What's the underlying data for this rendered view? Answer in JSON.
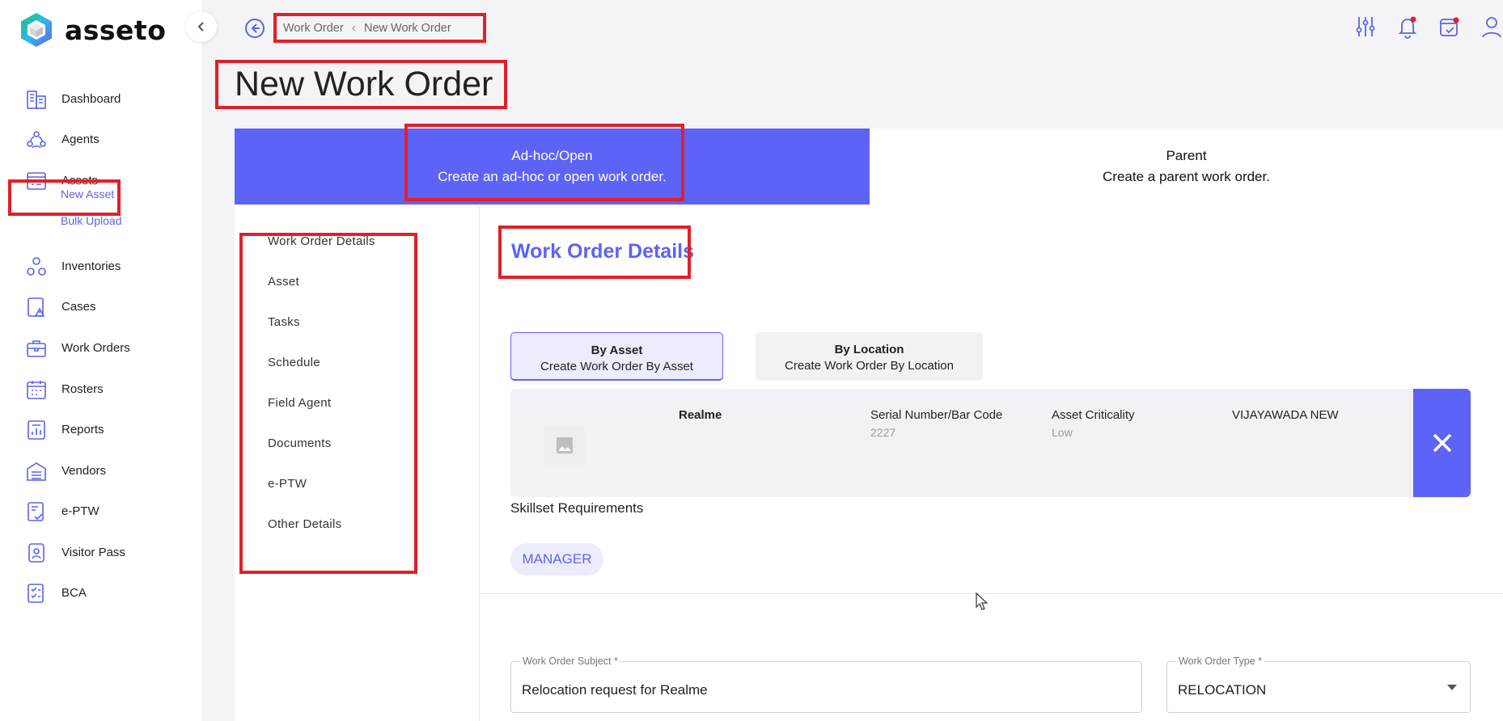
{
  "brand": {
    "name": "asseto"
  },
  "sidebar": {
    "items": [
      {
        "label": "Dashboard",
        "icon": "dashboard-icon"
      },
      {
        "label": "Agents",
        "icon": "agents-icon"
      },
      {
        "label": "Assets",
        "icon": "assets-icon"
      },
      {
        "label": "Inventories",
        "icon": "inventories-icon"
      },
      {
        "label": "Cases",
        "icon": "cases-icon"
      },
      {
        "label": "Work Orders",
        "icon": "work-orders-icon"
      },
      {
        "label": "Rosters",
        "icon": "rosters-icon"
      },
      {
        "label": "Reports",
        "icon": "reports-icon"
      },
      {
        "label": "Vendors",
        "icon": "vendors-icon"
      },
      {
        "label": "e-PTW",
        "icon": "eptw-icon"
      },
      {
        "label": "Visitor Pass",
        "icon": "visitor-pass-icon"
      },
      {
        "label": "BCA",
        "icon": "bca-icon"
      }
    ],
    "asset_subitems": [
      "New Asset",
      "Bulk Upload"
    ]
  },
  "breadcrumb": {
    "parent": "Work Order",
    "current": "New Work Order"
  },
  "page": {
    "title": "New Work Order"
  },
  "mode_tabs": [
    {
      "title": "Ad-hoc/Open",
      "subtitle": "Create an ad-hoc or open work order."
    },
    {
      "title": "Parent",
      "subtitle": "Create a parent work order."
    }
  ],
  "left_menu": [
    "Work Order Details",
    "Asset",
    "Tasks",
    "Schedule",
    "Field Agent",
    "Documents",
    "e-PTW",
    "Other Details"
  ],
  "section": {
    "title": "Work Order Details"
  },
  "segments": [
    {
      "title": "By Asset",
      "subtitle": "Create Work Order By Asset"
    },
    {
      "title": "By Location",
      "subtitle": "Create Work Order By Location"
    }
  ],
  "asset": {
    "name": "Realme",
    "serial_label": "Serial Number/Bar Code",
    "serial_value": "2227",
    "criticality_label": "Asset Criticality",
    "criticality_value": "Low",
    "location": "VIJAYAWADA NEW"
  },
  "skillset": {
    "label": "Skillset Requirements",
    "chips": [
      "MANAGER"
    ]
  },
  "form": {
    "subject_label": "Work Order Subject *",
    "subject_value": "Relocation request for Realme",
    "type_label": "Work Order Type *",
    "type_value": "RELOCATION"
  },
  "colors": {
    "accent": "#5c63f6",
    "highlight_box": "#e0202a"
  }
}
